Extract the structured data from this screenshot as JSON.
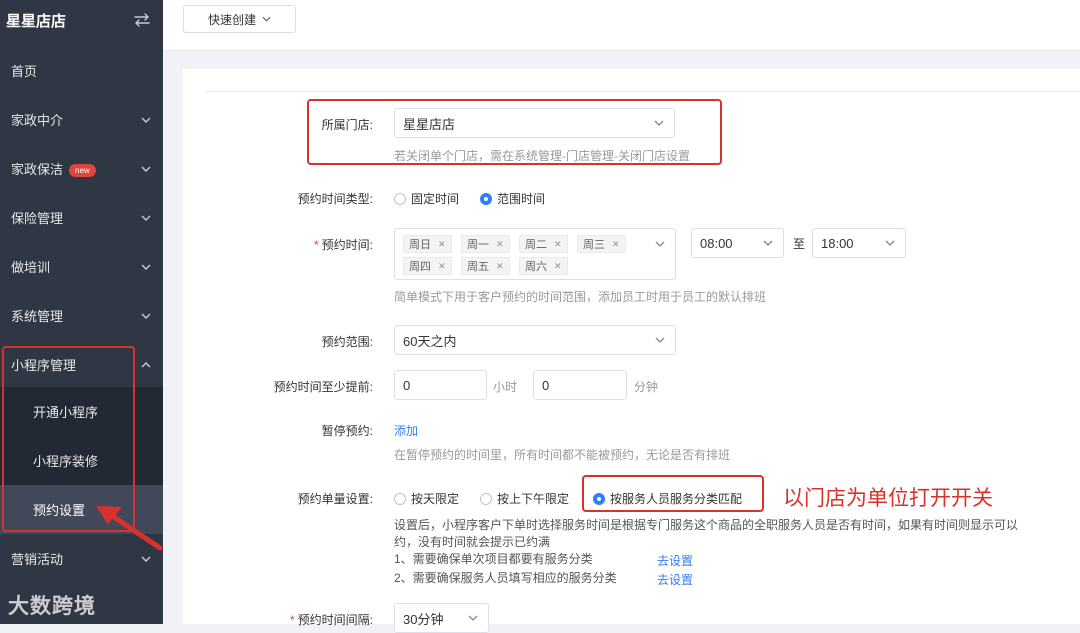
{
  "sidebar": {
    "brand": "星星店店",
    "items": [
      {
        "label": "首页"
      },
      {
        "label": "家政中介"
      },
      {
        "label": "家政保洁",
        "badge": "new"
      },
      {
        "label": "保险管理"
      },
      {
        "label": "做培训"
      },
      {
        "label": "系统管理"
      },
      {
        "label": "小程序管理"
      },
      {
        "label": "营销活动"
      }
    ],
    "submenu": [
      {
        "label": "开通小程序"
      },
      {
        "label": "小程序装修"
      },
      {
        "label": "预约设置"
      }
    ],
    "watermark": "大数跨境",
    "colors": {
      "bg": "#2f3644",
      "accent": "#2d7ff9",
      "highlight": "#d9312b"
    }
  },
  "topbar": {
    "quick_create": "快速创建"
  },
  "form": {
    "store": {
      "label": "所属门店:",
      "value": "星星店店",
      "hint": "若关闭单个门店，需在系统管理-门店管理-关闭门店设置"
    },
    "time_type": {
      "label": "预约时间类型:",
      "options": [
        "固定时间",
        "范围时间"
      ],
      "selected": "范围时间"
    },
    "time": {
      "label": "预约时间:",
      "days": [
        "周日",
        "周一",
        "周二",
        "周三",
        "周四",
        "周五",
        "周六"
      ],
      "start": "08:00",
      "sep": "至",
      "end": "18:00",
      "hint": "简单模式下用于客户预约的时间范围，添加员工时用于员工的默认排班"
    },
    "range": {
      "label": "预约范围:",
      "value": "60天之内"
    },
    "advance": {
      "label": "预约时间至少提前:",
      "hours": "0",
      "hours_unit": "小时",
      "minutes": "0",
      "minutes_unit": "分钟"
    },
    "pause": {
      "label": "暂停预约:",
      "add_link": "添加",
      "hint": "在暂停预约的时间里，所有时间都不能被预约，无论是否有排班"
    },
    "quota": {
      "label": "预约单量设置:",
      "options": [
        "按天限定",
        "按上下午限定",
        "按服务人员服务分类匹配"
      ],
      "selected": "按服务人员服务分类匹配",
      "annotation": "以门店为单位打开开关",
      "note_line1": "设置后，小程序客户下单时选择服务时间是根据专门服务这个商品的全职服务人员是否有时间，如果有时间则显示可以",
      "note_line2": "约，没有时间就会提示已约满",
      "req1": "1、需要确保单次项目都要有服务分类",
      "req2": "2、需要确保服务人员填写相应的服务分类",
      "goto": "去设置"
    },
    "interval": {
      "label": "预约时间间隔:",
      "value": "30分钟"
    }
  }
}
